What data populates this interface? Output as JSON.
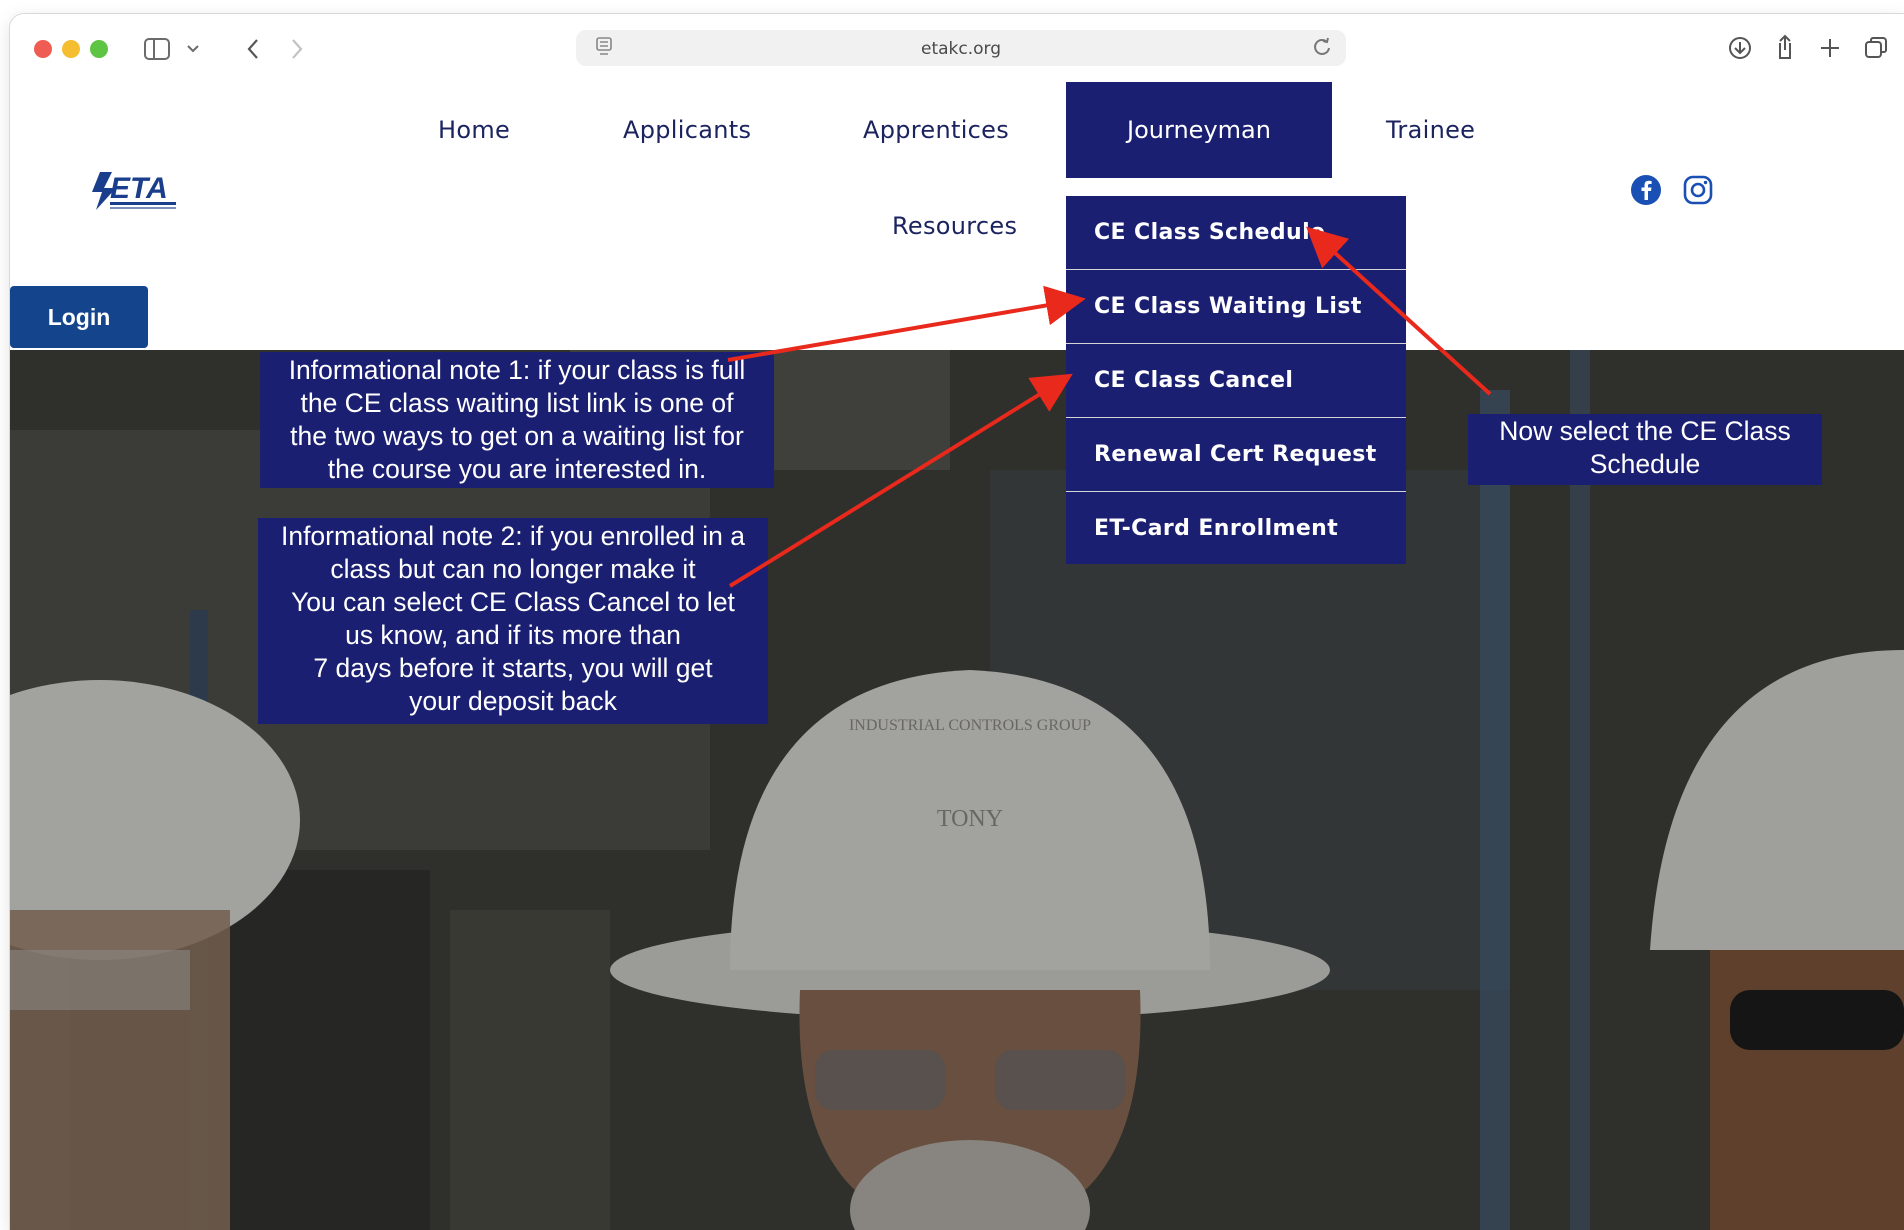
{
  "browser": {
    "url": "etakc.org"
  },
  "site": {
    "logo_text": "ETA",
    "nav": {
      "home": "Home",
      "applicants": "Applicants",
      "apprentices": "Apprentices",
      "journeyman": "Journeyman",
      "trainee": "Trainee",
      "resources": "Resources"
    },
    "login_label": "Login",
    "social_icons": [
      "facebook-icon",
      "instagram-icon"
    ]
  },
  "dropdown": {
    "items": [
      {
        "label": "CE Class Schedule"
      },
      {
        "label": "CE Class Waiting List"
      },
      {
        "label": "CE Class Cancel"
      },
      {
        "label": "Renewal Cert Request"
      },
      {
        "label": "ET-Card Enrollment"
      }
    ]
  },
  "annotations": {
    "note1": "Informational note 1: if your class is full\nthe CE class waiting list link is one of\nthe two ways to get on a waiting list for\nthe course you are interested in.",
    "note2": "Informational note 2: if you enrolled in a\nclass but can no longer make it\nYou can select CE Class Cancel to let\nus know, and if its more than\n7 days before it starts, you will get\nyour deposit back",
    "note3": "Now select the CE Class\nSchedule"
  },
  "hero": {
    "hardhat_text": "INDUSTRIAL CONTROLS GROUP",
    "name_on_hat": "TONY"
  },
  "colors": {
    "brand_navy": "#1a1f71",
    "login_blue": "#14458c",
    "arrow_red": "#e8291c",
    "nav_text": "#1c2460"
  }
}
